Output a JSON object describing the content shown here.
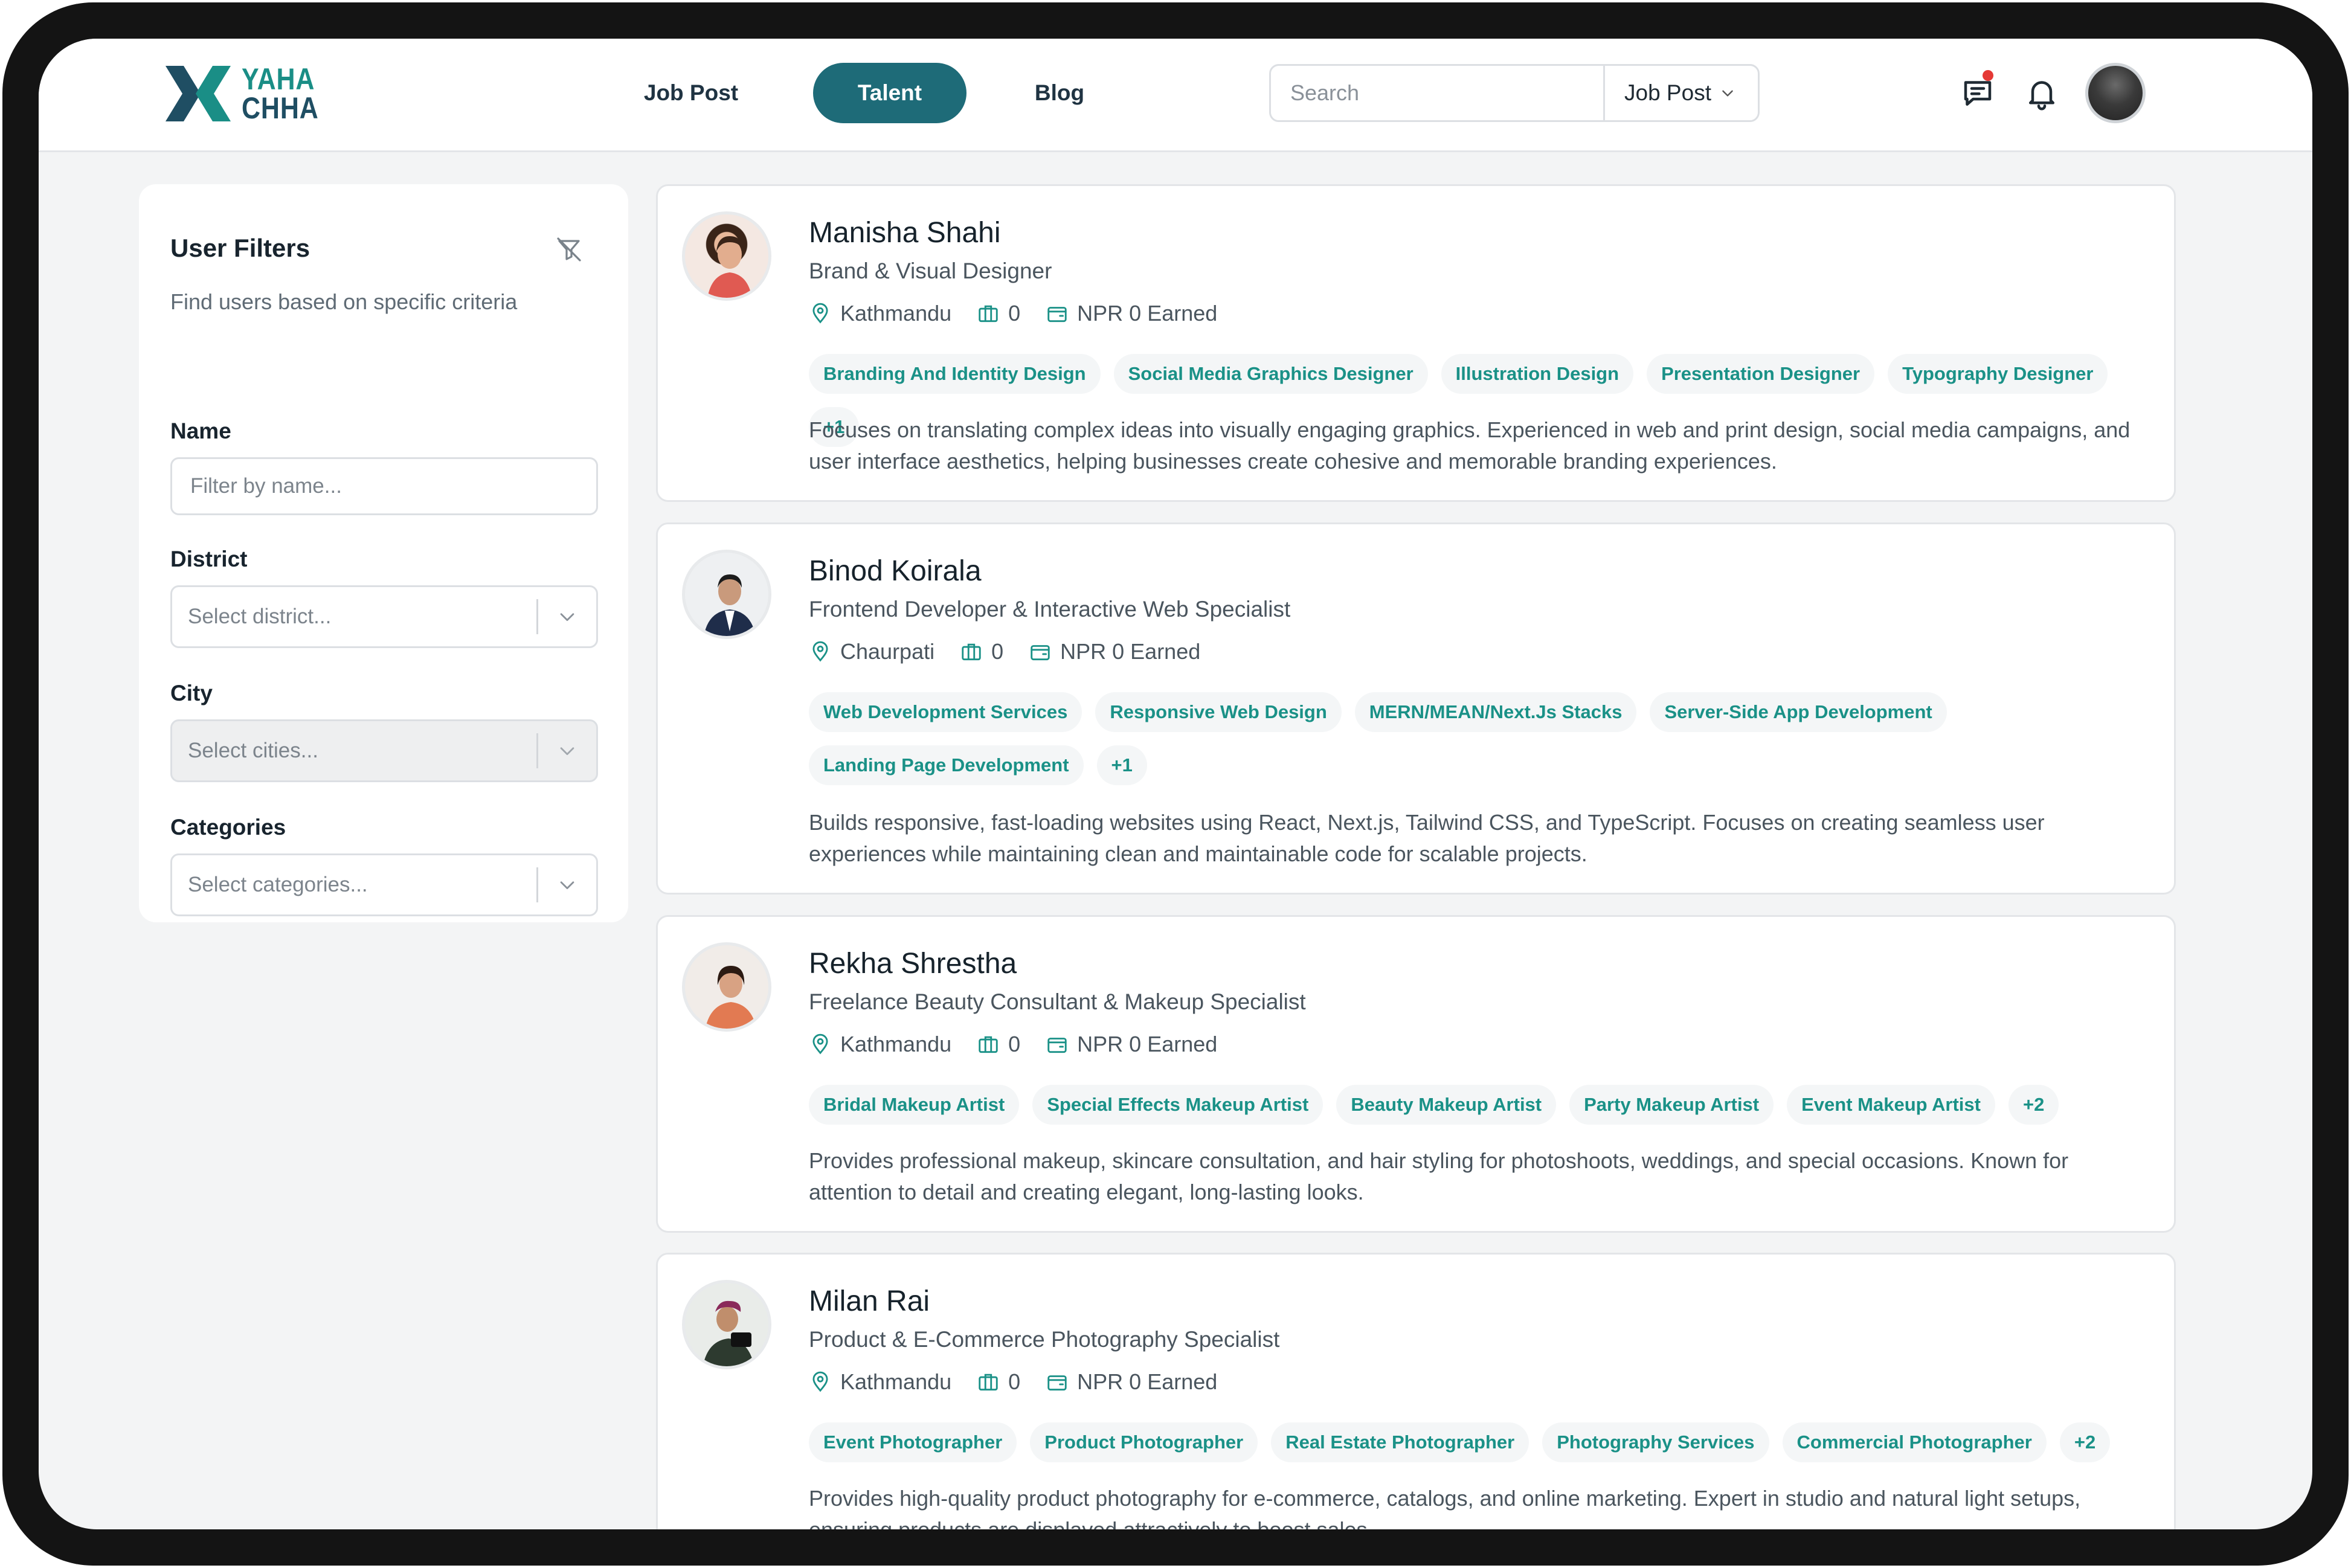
{
  "brand": {
    "line1": "YAHA",
    "line2": "CHHA"
  },
  "nav": [
    {
      "label": "Job Post",
      "active": false
    },
    {
      "label": "Talent",
      "active": true
    },
    {
      "label": "Blog",
      "active": false
    }
  ],
  "search": {
    "placeholder": "Search",
    "type_label": "Job Post"
  },
  "colors": {
    "primary": "#1e6b78",
    "accent": "#1a9187",
    "notif": "#e53935"
  },
  "sidebar": {
    "title": "User Filters",
    "subtitle": "Find users based on specific criteria",
    "name_label": "Name",
    "name_placeholder": "Filter by name...",
    "district_label": "District",
    "district_placeholder": "Select district...",
    "city_label": "City",
    "city_placeholder": "Select cities...",
    "categories_label": "Categories",
    "categories_placeholder": "Select categories..."
  },
  "talents": [
    {
      "name": "Manisha Shahi",
      "title": "Brand & Visual Designer",
      "location": "Kathmandu",
      "jobs": "0",
      "earned": "NPR 0 Earned",
      "tags": [
        "Branding And Identity Design",
        "Social Media Graphics Designer",
        "Illustration Design",
        "Presentation Designer",
        "Typography Designer",
        "+1"
      ],
      "description": "Focuses on translating complex ideas into visually engaging graphics. Experienced in web and print design, social media campaigns, and user interface aesthetics, helping businesses create cohesive and memorable branding experiences."
    },
    {
      "name": "Binod Koirala",
      "title": "Frontend Developer & Interactive Web Specialist",
      "location": "Chaurpati",
      "jobs": "0",
      "earned": "NPR 0 Earned",
      "tags": [
        "Web Development Services",
        "Responsive Web Design",
        "MERN/MEAN/Next.Js Stacks",
        "Server-Side App Development",
        "Landing Page Development",
        "+1"
      ],
      "description": "Builds responsive, fast-loading websites using React, Next.js, Tailwind CSS, and TypeScript. Focuses on creating seamless user experiences while maintaining clean and maintainable code for scalable projects."
    },
    {
      "name": "Rekha Shrestha",
      "title": "Freelance Beauty Consultant & Makeup Specialist",
      "location": "Kathmandu",
      "jobs": "0",
      "earned": "NPR 0 Earned",
      "tags": [
        "Bridal Makeup Artist",
        "Special Effects Makeup Artist",
        "Beauty Makeup Artist",
        "Party Makeup Artist",
        "Event Makeup Artist",
        "+2"
      ],
      "description": "Provides professional makeup, skincare consultation, and hair styling for photoshoots, weddings, and special occasions. Known for attention to detail and creating elegant, long-lasting looks."
    },
    {
      "name": "Milan Rai",
      "title": "Product & E-Commerce Photography Specialist",
      "location": "Kathmandu",
      "jobs": "0",
      "earned": "NPR 0 Earned",
      "tags": [
        "Event Photographer",
        "Product Photographer",
        "Real Estate Photographer",
        "Photography Services",
        "Commercial Photographer",
        "+2"
      ],
      "description": "Provides high-quality product photography for e-commerce, catalogs, and online marketing. Expert in studio and natural light setups, ensuring products are displayed attractively to boost sales."
    }
  ]
}
